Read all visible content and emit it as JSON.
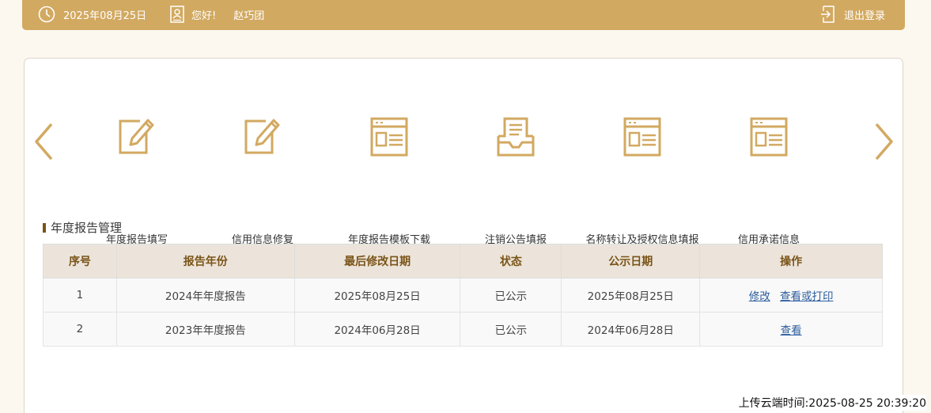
{
  "topbar": {
    "date": "2025年08月25日",
    "greeting": "您好!",
    "username": "赵巧团",
    "logout_label": "退出登录"
  },
  "icons": {
    "clock": "clock-icon",
    "user": "user-card-icon",
    "logout": "logout-icon",
    "prev": "chevron-left-icon",
    "next": "chevron-right-icon"
  },
  "nav": {
    "items": [
      {
        "label": "年度报告填写",
        "icon": "edit-icon"
      },
      {
        "label": "信用信息修复",
        "icon": "edit-icon"
      },
      {
        "label": "年度报告模板下载",
        "icon": "document-list-icon"
      },
      {
        "label": "注销公告填报",
        "icon": "inbox-document-icon"
      },
      {
        "label": "名称转让及授权信息填报",
        "icon": "document-list-icon"
      },
      {
        "label": "信用承诺信息",
        "icon": "document-list-icon"
      }
    ]
  },
  "section": {
    "title": "年度报告管理"
  },
  "table": {
    "headers": [
      "序号",
      "报告年份",
      "最后修改日期",
      "状态",
      "公示日期",
      "操作"
    ],
    "rows": [
      {
        "index": "1",
        "year": "2024年年度报告",
        "modified": "2025年08月25日",
        "status": "已公示",
        "publish": "2025年08月25日",
        "actions": [
          "修改",
          "查看或打印"
        ]
      },
      {
        "index": "2",
        "year": "2023年年度报告",
        "modified": "2024年06月28日",
        "status": "已公示",
        "publish": "2024年06月28日",
        "actions": [
          "查看"
        ]
      }
    ]
  },
  "footer": {
    "upload_time": "上传云端时间:2025-08-25 20:39:20"
  },
  "colors": {
    "accent": "#d2a961",
    "header_text": "#7a5418",
    "link": "#2d5d9f"
  }
}
